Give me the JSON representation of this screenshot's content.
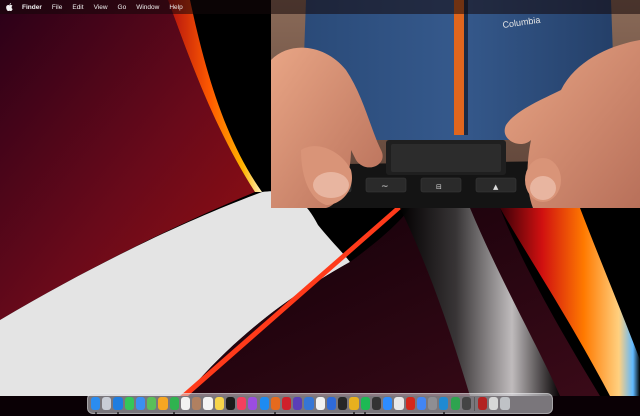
{
  "menubar": {
    "apple_icon": "apple-icon",
    "app_name": "Finder",
    "items": [
      "File",
      "Edit",
      "View",
      "Go",
      "Window",
      "Help"
    ]
  },
  "webcam": {
    "shirt_logo_text": "Columbia",
    "keyboard_keys": [
      "~",
      "⊟",
      "▲"
    ]
  },
  "dock": {
    "apps_left": [
      {
        "icon": "finder-icon",
        "color": "#2a8cf0",
        "running": true
      },
      {
        "icon": "launchpad-icon",
        "color": "#c9cdd6",
        "running": false
      },
      {
        "icon": "safari-icon",
        "color": "#1f7de0",
        "running": true
      },
      {
        "icon": "messages-icon",
        "color": "#34c759",
        "running": false
      },
      {
        "icon": "mail-icon",
        "color": "#3b8ff2",
        "running": false
      },
      {
        "icon": "maps-icon",
        "color": "#5bbf5a",
        "running": false
      },
      {
        "icon": "photos-icon",
        "color": "#f5a623",
        "running": false
      },
      {
        "icon": "facetime-icon",
        "color": "#2fb34f",
        "running": true
      },
      {
        "icon": "calendar-icon",
        "color": "#f2f2f2",
        "running": false
      },
      {
        "icon": "contacts-icon",
        "color": "#b08060",
        "running": false
      },
      {
        "icon": "reminders-icon",
        "color": "#f4f4f4",
        "running": false
      },
      {
        "icon": "notes-icon",
        "color": "#f7d54a",
        "running": false
      },
      {
        "icon": "tv-icon",
        "color": "#1a1a1a",
        "running": false
      },
      {
        "icon": "music-icon",
        "color": "#f43f5e",
        "running": false
      },
      {
        "icon": "podcasts-icon",
        "color": "#9b4de0",
        "running": false
      },
      {
        "icon": "appstore-icon",
        "color": "#1d8bf1",
        "running": false
      },
      {
        "icon": "firefox-icon",
        "color": "#e66a1e",
        "running": true
      },
      {
        "icon": "opera-icon",
        "color": "#d0202a",
        "running": false
      },
      {
        "icon": "checkbox-icon",
        "color": "#5a3fb8",
        "running": false
      },
      {
        "icon": "editor-icon",
        "color": "#3576d6",
        "running": false
      },
      {
        "icon": "notion-icon",
        "color": "#f2f2f2",
        "running": false
      },
      {
        "icon": "xcode-icon",
        "color": "#2f6ad9",
        "running": false
      },
      {
        "icon": "terminal-icon",
        "color": "#262626",
        "running": false
      },
      {
        "icon": "chrome-icon",
        "color": "#e8b01f",
        "running": true
      },
      {
        "icon": "spotify-icon",
        "color": "#1db954",
        "running": true
      },
      {
        "icon": "activity-icon",
        "color": "#333333",
        "running": false
      },
      {
        "icon": "zoom-icon",
        "color": "#2d8cff",
        "running": false
      },
      {
        "icon": "preview-icon",
        "color": "#e9e9e9",
        "running": false
      },
      {
        "icon": "acrobat-icon",
        "color": "#d4271b",
        "running": false
      },
      {
        "icon": "docs-icon",
        "color": "#4285f4",
        "running": false
      },
      {
        "icon": "settings-icon",
        "color": "#8e8e93",
        "running": false
      },
      {
        "icon": "vscode-icon",
        "color": "#1f8ad2",
        "running": true
      },
      {
        "icon": "script-icon",
        "color": "#2ea44f",
        "running": false
      },
      {
        "icon": "console-icon",
        "color": "#444444",
        "running": false
      }
    ],
    "apps_right": [
      {
        "icon": "recording-icon",
        "color": "#b22222",
        "running": false
      },
      {
        "icon": "downloads-icon",
        "color": "#d7d7d7",
        "running": false
      },
      {
        "icon": "trash-icon",
        "color": "#bfc2c6",
        "running": false
      }
    ]
  }
}
